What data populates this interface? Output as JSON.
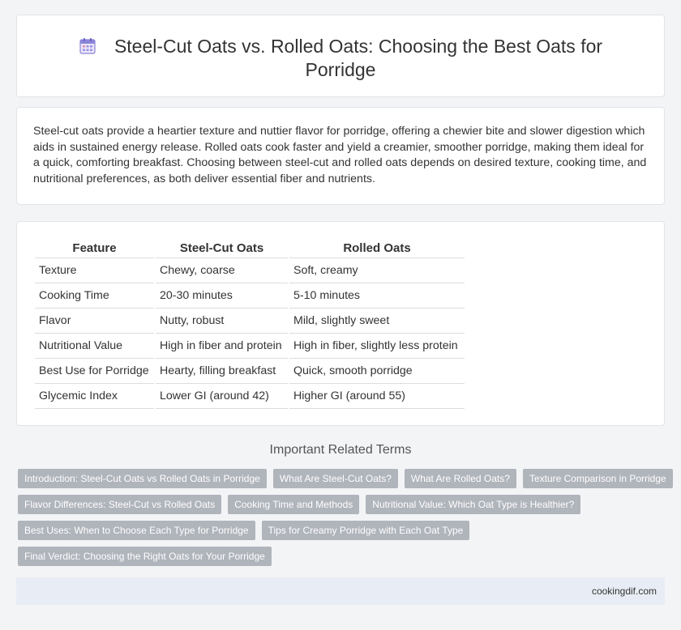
{
  "header": {
    "title": "Steel-Cut Oats vs. Rolled Oats: Choosing the Best Oats for Porridge",
    "icon": "calendar-icon"
  },
  "intro": {
    "text": "Steel-cut oats provide a heartier texture and nuttier flavor for porridge, offering a chewier bite and slower digestion which aids in sustained energy release. Rolled oats cook faster and yield a creamier, smoother porridge, making them ideal for a quick, comforting breakfast. Choosing between steel-cut and rolled oats depends on desired texture, cooking time, and nutritional preferences, as both deliver essential fiber and nutrients."
  },
  "table": {
    "headers": [
      "Feature",
      "Steel-Cut Oats",
      "Rolled Oats"
    ],
    "rows": [
      [
        "Texture",
        "Chewy, coarse",
        "Soft, creamy"
      ],
      [
        "Cooking Time",
        "20-30 minutes",
        "5-10 minutes"
      ],
      [
        "Flavor",
        "Nutty, robust",
        "Mild, slightly sweet"
      ],
      [
        "Nutritional Value",
        "High in fiber and protein",
        "High in fiber, slightly less protein"
      ],
      [
        "Best Use for Porridge",
        "Hearty, filling breakfast",
        "Quick, smooth porridge"
      ],
      [
        "Glycemic Index",
        "Lower GI (around 42)",
        "Higher GI (around 55)"
      ]
    ]
  },
  "related": {
    "title": "Important Related Terms",
    "tag_rows": [
      [
        "Introduction: Steel-Cut Oats vs Rolled Oats in Porridge",
        "What Are Steel-Cut Oats?",
        "What Are Rolled Oats?",
        "Texture Comparison in Porridge"
      ],
      [
        "Flavor Differences: Steel-Cut vs Rolled Oats",
        "Cooking Time and Methods",
        "Nutritional Value: Which Oat Type is Healthier?"
      ],
      [
        "Best Uses: When to Choose Each Type for Porridge",
        "Tips for Creamy Porridge with Each Oat Type"
      ],
      [
        "Final Verdict: Choosing the Right Oats for Your Porridge"
      ]
    ]
  },
  "footer": {
    "site": "cookingdif.com"
  },
  "colors": {
    "tag_bg": "#b0b4bb",
    "footer_bg": "#e8edf5",
    "page_bg": "#f3f4f6"
  }
}
